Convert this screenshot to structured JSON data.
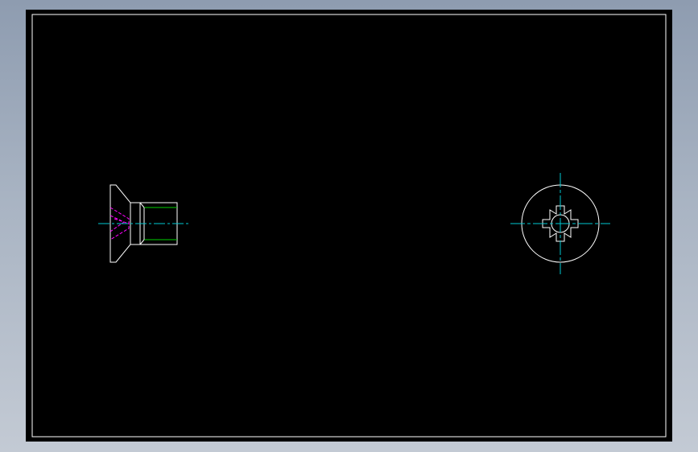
{
  "colors": {
    "background": "#8e9cb0",
    "sheet": "#000000",
    "border": "#ffffff",
    "outline": "#ffffff",
    "centerline": "#00c8d2",
    "hidden_line": "#ff00ff",
    "thread_line": "#00d000"
  },
  "views": [
    {
      "name": "side-view",
      "type": "countersunk-screw-profile"
    },
    {
      "name": "end-view",
      "type": "screw-head-with-splined-recess"
    }
  ]
}
